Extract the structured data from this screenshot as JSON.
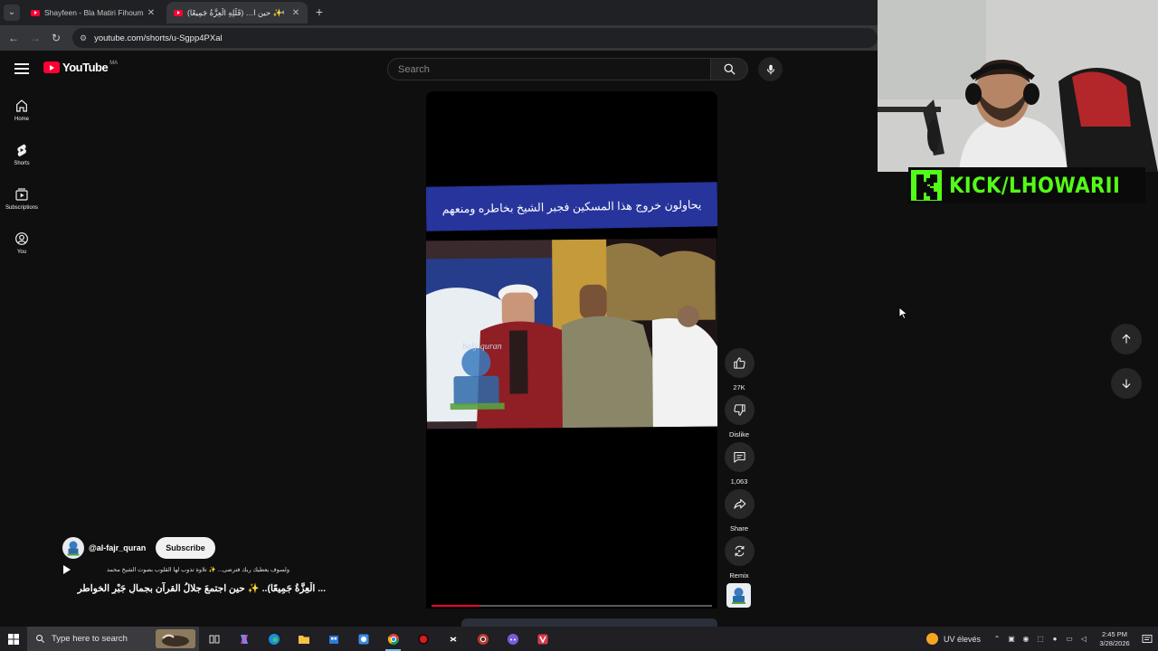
{
  "browser": {
    "tabs": [
      {
        "title": "Shayfeen - Bla Matiri Fihoum (O",
        "active": false
      },
      {
        "title": "حين ا… (قَلِّلِهِ الْعِزَّةُ جَمِيعًا) ✨",
        "active": true
      }
    ],
    "url": "youtube.com/shorts/u-Sgpp4PXal"
  },
  "youtube": {
    "logo_text": "YouTube",
    "country_code": "MA",
    "search_placeholder": "Search",
    "guide": [
      {
        "label": "Home",
        "icon": "home-icon"
      },
      {
        "label": "Shorts",
        "icon": "shorts-icon"
      },
      {
        "label": "Subscriptions",
        "icon": "subscriptions-icon"
      },
      {
        "label": "You",
        "icon": "you-icon"
      }
    ]
  },
  "short": {
    "overlay_caption": "يحاولون خروج هذا المسكين فجبر الشيخ بخاطره ومنعهم",
    "watermark_text": "holy quran",
    "progress_fraction": 0.17,
    "channel": "@al-fajr_quran",
    "subscribe_label": "Subscribe",
    "description": "ولسوف يعطيك ربك فترضى... ✨ تلاوة تذوب لها القلوب بصوت الشيخ محمد",
    "title": "... الْعِزَّةُ جَمِيعًا).. ✨ حين اجتمعَ جلالُ القرآن بجمالِ جَبْرِ الخواطر"
  },
  "actions": [
    {
      "label": "27K",
      "icon": "like-icon"
    },
    {
      "label": "Dislike",
      "icon": "dislike-icon"
    },
    {
      "label": "1,063",
      "icon": "comment-icon"
    },
    {
      "label": "Share",
      "icon": "share-icon"
    },
    {
      "label": "Remix",
      "icon": "remix-icon"
    }
  ],
  "stream_overlay": {
    "kick_text": "KICK/LHOWARII",
    "kick_color": "#53fc18"
  },
  "taskbar": {
    "search_placeholder": "Type here to search",
    "weather_text": "UV élevés",
    "time": "2:45 PM",
    "date": "3/28/2026"
  },
  "colors": {
    "youtube_red": "#ff0033",
    "background": "#0f0f0f",
    "caption_band": "#26349c"
  }
}
